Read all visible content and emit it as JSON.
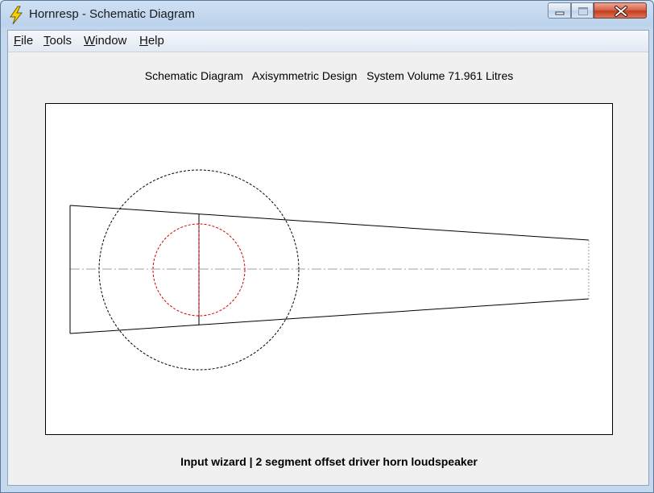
{
  "window": {
    "title": "Hornresp - Schematic Diagram"
  },
  "menu": [
    {
      "accel": "F",
      "rest": "ile"
    },
    {
      "accel": "T",
      "rest": "ools"
    },
    {
      "accel": "W",
      "rest": "indow"
    },
    {
      "accel": "H",
      "rest": "elp"
    }
  ],
  "diagram": {
    "heading": "Schematic Diagram   Axisymmetric Design   System Volume 71.961 Litres"
  },
  "status": {
    "text": "Input wizard | 2 segment offset driver horn loudspeaker"
  },
  "colors": {
    "outline": "#000000",
    "driver": "#d40000",
    "centerline": "#a0a0a0"
  },
  "icons": {
    "app": "lightning-icon",
    "minimize": "minimize-icon",
    "maximize": "maximize-icon",
    "close": "close-icon"
  }
}
